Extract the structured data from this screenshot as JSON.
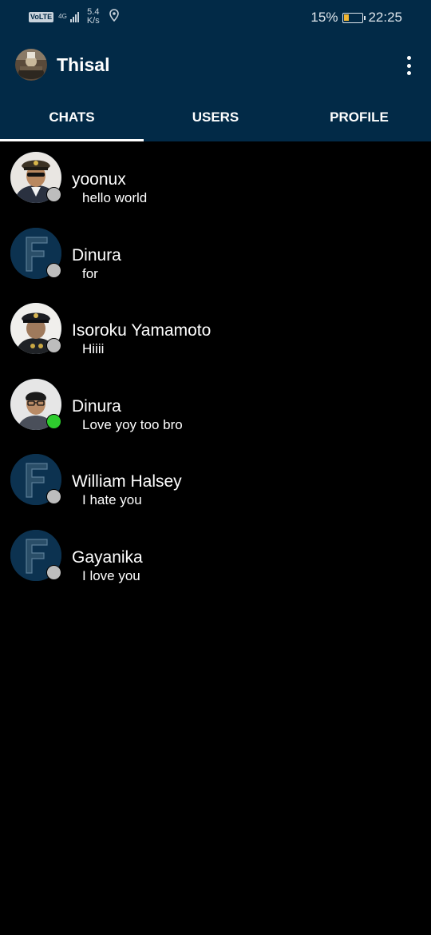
{
  "status_bar": {
    "volte": "VoLTE",
    "network": "4G",
    "network_sub": "1↑.ıl",
    "speed_value": "5.4",
    "speed_unit": "K/s",
    "battery_pct": "15%",
    "time": "22:25"
  },
  "app": {
    "title": "Thisal"
  },
  "tabs": [
    {
      "label": "CHATS",
      "active": true
    },
    {
      "label": "USERS",
      "active": false
    },
    {
      "label": "PROFILE",
      "active": false
    }
  ],
  "chats": [
    {
      "name": "yoonux",
      "message": "hello world",
      "avatar": "photo",
      "online": false
    },
    {
      "name": "Dinura",
      "message": "for",
      "avatar": "default-f",
      "online": false
    },
    {
      "name": "Isoroku Yamamoto",
      "message": "Hiiii",
      "avatar": "photo",
      "online": false
    },
    {
      "name": "Dinura",
      "message": "Love yoy too bro",
      "avatar": "photo",
      "online": true
    },
    {
      "name": "William Halsey",
      "message": "I hate you",
      "avatar": "default-f",
      "online": false
    },
    {
      "name": "Gayanika",
      "message": "I love you",
      "avatar": "default-f",
      "online": false
    }
  ],
  "colors": {
    "header_bg": "#022a47",
    "list_bg": "#000000",
    "online": "#2ecc2e",
    "offline": "#bdbdbd"
  }
}
